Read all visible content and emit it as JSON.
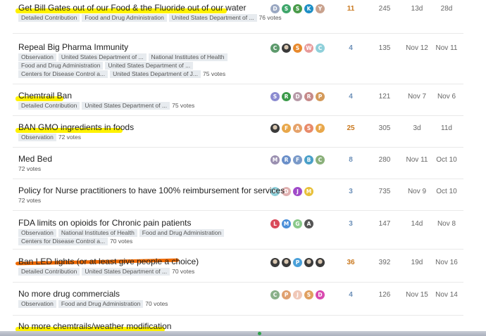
{
  "topics": [
    {
      "title": "Get Bill Gates out of our Food & the Fluoride out of our water",
      "highlight": "yellow",
      "tag_lines": [
        [
          "Detailed Contribution",
          "Food and Drug Administration",
          "United States Department of ..."
        ]
      ],
      "votes": "76 votes",
      "avatars": [
        {
          "letter": "D",
          "color": "#9aa8c2"
        },
        {
          "letter": "S",
          "color": "#3fa66b"
        },
        {
          "letter": "S",
          "color": "#4a9b4a"
        },
        {
          "letter": "K",
          "color": "#1e8fc6"
        },
        {
          "letter": "Y",
          "color": "#c9a28e"
        }
      ],
      "replies": "11",
      "hot": true,
      "views": "245",
      "activity": "13d",
      "last": "28d"
    },
    {
      "title": "Repeal Big Pharma Immunity",
      "highlight": "",
      "tag_lines": [
        [
          "Observation",
          "United States Department of ...",
          "National Institutes of Health"
        ],
        [
          "Food and Drug Administration",
          "United States Department of ..."
        ],
        [
          "Centers for Disease Control a...",
          "United States Department of J..."
        ]
      ],
      "votes": "75 votes",
      "avatars": [
        {
          "letter": "C",
          "color": "#5d9a6c"
        },
        {
          "letter": "",
          "color": "photo"
        },
        {
          "letter": "S",
          "color": "#e8892c"
        },
        {
          "letter": "W",
          "color": "#e79a9a"
        },
        {
          "letter": "C",
          "color": "#8fd0da"
        }
      ],
      "replies": "4",
      "hot": false,
      "views": "135",
      "activity": "Nov 12",
      "last": "Nov 11"
    },
    {
      "title": "Chemtrail Ban",
      "highlight": "yellow",
      "tag_lines": [
        [
          "Detailed Contribution",
          "United States Department of ..."
        ]
      ],
      "votes": "75 votes",
      "avatars": [
        {
          "letter": "S",
          "color": "#8b8bd0"
        },
        {
          "letter": "R",
          "color": "#3c9a4a"
        },
        {
          "letter": "D",
          "color": "#b79aa8"
        },
        {
          "letter": "R",
          "color": "#c68a8a"
        },
        {
          "letter": "P",
          "color": "#d49a5a"
        }
      ],
      "replies": "4",
      "hot": false,
      "views": "121",
      "activity": "Nov 7",
      "last": "Nov 6"
    },
    {
      "title": "BAN GMO ingredients in foods",
      "highlight": "yellow",
      "tag_lines": [
        [
          "Observation"
        ]
      ],
      "votes": "72 votes",
      "avatars": [
        {
          "letter": "",
          "color": "photo"
        },
        {
          "letter": "F",
          "color": "#e8a74a"
        },
        {
          "letter": "A",
          "color": "#e5a26a"
        },
        {
          "letter": "S",
          "color": "#e88a6a"
        },
        {
          "letter": "F",
          "color": "#e8a74a"
        }
      ],
      "replies": "25",
      "hot": true,
      "views": "305",
      "activity": "3d",
      "last": "11d"
    },
    {
      "title": "Med Bed",
      "highlight": "",
      "tag_lines": [],
      "votes": "72 votes",
      "avatars": [
        {
          "letter": "M",
          "color": "#9a8fb0"
        },
        {
          "letter": "R",
          "color": "#6a8fc9"
        },
        {
          "letter": "F",
          "color": "#7a9ac9"
        },
        {
          "letter": "B",
          "color": "#4aa0c9"
        },
        {
          "letter": "C",
          "color": "#8ab07a"
        }
      ],
      "replies": "8",
      "hot": false,
      "views": "280",
      "activity": "Nov 11",
      "last": "Oct 10"
    },
    {
      "title": "Policy for Nurse practitioners to have 100% reimbursement for services",
      "highlight": "",
      "tag_lines": [],
      "votes": "72 votes",
      "avatars": [
        {
          "letter": "D",
          "color": "#8fd0da"
        },
        {
          "letter": "D",
          "color": "#e0b0b0"
        },
        {
          "letter": "J",
          "color": "#a04ac9"
        },
        {
          "letter": "M",
          "color": "#e8c03a"
        }
      ],
      "replies": "3",
      "hot": false,
      "views": "735",
      "activity": "Nov 9",
      "last": "Oct 10"
    },
    {
      "title": "FDA limits on opioids for Chronic pain patients",
      "highlight": "",
      "tag_lines": [
        [
          "Observation",
          "National Institutes of Health",
          "Food and Drug Administration"
        ],
        [
          "Centers for Disease Control a..."
        ]
      ],
      "votes": "70 votes",
      "avatars": [
        {
          "letter": "L",
          "color": "#d94a5a"
        },
        {
          "letter": "M",
          "color": "#4a8fd9"
        },
        {
          "letter": "G",
          "color": "#8ac98a"
        },
        {
          "letter": "A",
          "color": "#555555"
        }
      ],
      "replies": "3",
      "hot": false,
      "views": "147",
      "activity": "14d",
      "last": "Nov 8"
    },
    {
      "title": "Ban LED lights (or at least give people a choice)",
      "highlight": "orange",
      "tag_lines": [
        [
          "Detailed Contribution",
          "United States Department of ..."
        ]
      ],
      "votes": "70 votes",
      "avatars": [
        {
          "letter": "",
          "color": "photo"
        },
        {
          "letter": "",
          "color": "photo"
        },
        {
          "letter": "P",
          "color": "#4aa0d9"
        },
        {
          "letter": "",
          "color": "photo"
        },
        {
          "letter": "",
          "color": "photo"
        }
      ],
      "replies": "36",
      "hot": true,
      "views": "392",
      "activity": "19d",
      "last": "Nov 16"
    },
    {
      "title": "No more drug commercials",
      "highlight": "",
      "tag_lines": [
        [
          "Observation",
          "Food and Drug Administration"
        ]
      ],
      "votes": "70 votes",
      "avatars": [
        {
          "letter": "C",
          "color": "#8ab08a"
        },
        {
          "letter": "P",
          "color": "#e0a070"
        },
        {
          "letter": "J",
          "color": "#f0c8b8"
        },
        {
          "letter": "S",
          "color": "#e0a060"
        },
        {
          "letter": "D",
          "color": "#d94ab0"
        }
      ],
      "replies": "4",
      "hot": false,
      "views": "126",
      "activity": "Nov 15",
      "last": "Nov 14"
    },
    {
      "title": "No more chemtrails/weather modification",
      "highlight": "yellow",
      "tag_lines": [],
      "votes": "",
      "avatars": [],
      "replies": "",
      "hot": false,
      "views": "",
      "activity": "",
      "last": ""
    }
  ]
}
